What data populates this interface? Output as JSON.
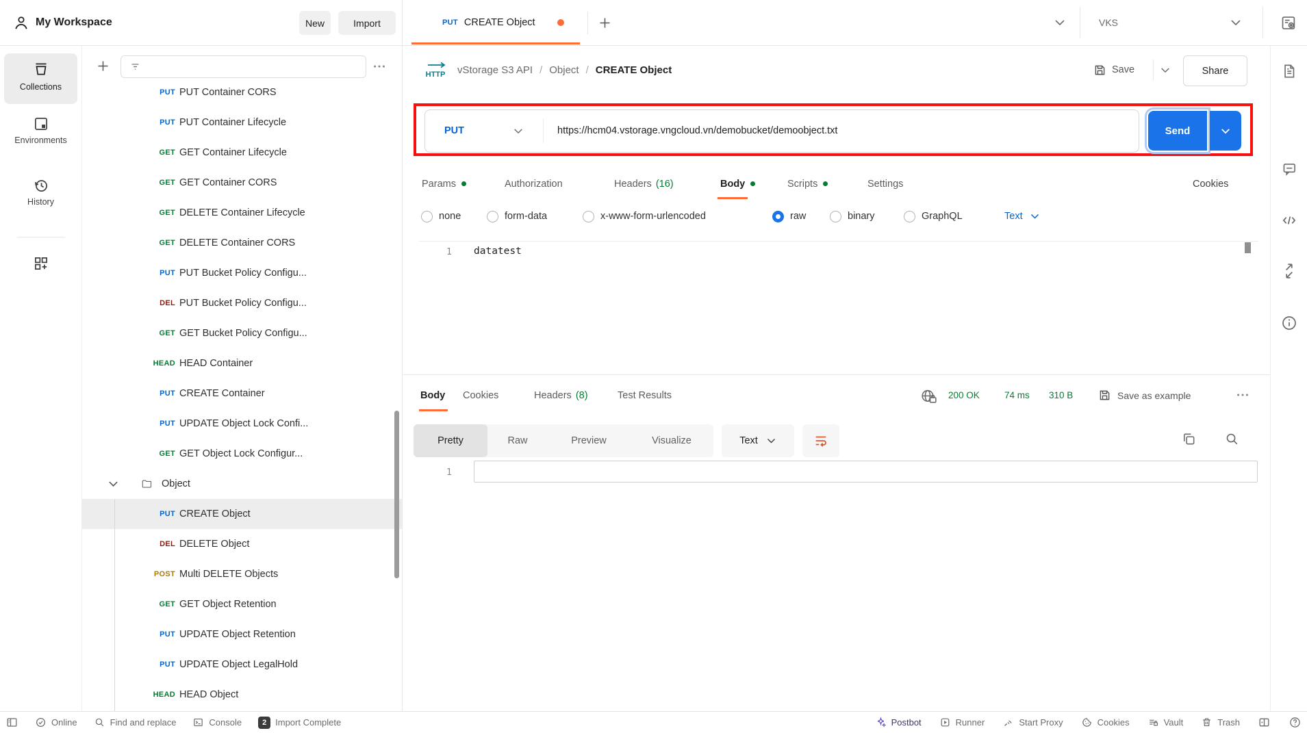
{
  "header": {
    "workspace_name": "My Workspace",
    "new_button": "New",
    "import_button": "Import"
  },
  "tab_bar": {
    "tab_method": "PUT",
    "tab_title": "CREATE Object",
    "environment_name": "VKS"
  },
  "nav_rail": {
    "collections": "Collections",
    "environments": "Environments",
    "history": "History"
  },
  "sidebar": {
    "items": [
      {
        "method": "PUT",
        "label": "PUT Container CORS"
      },
      {
        "method": "PUT",
        "label": "PUT Container Lifecycle"
      },
      {
        "method": "GET",
        "label": "GET Container Lifecycle"
      },
      {
        "method": "GET",
        "label": "GET Container CORS"
      },
      {
        "method": "GET",
        "label": "DELETE Container Lifecycle"
      },
      {
        "method": "GET",
        "label": "DELETE Container CORS"
      },
      {
        "method": "PUT",
        "label": "PUT Bucket Policy Configu..."
      },
      {
        "method": "DEL",
        "label": "PUT Bucket Policy Configu..."
      },
      {
        "method": "GET",
        "label": "GET Bucket Policy Configu..."
      },
      {
        "method": "HEAD",
        "label": "HEAD Container"
      },
      {
        "method": "PUT",
        "label": "CREATE Container"
      },
      {
        "method": "PUT",
        "label": "UPDATE Object Lock Confi..."
      },
      {
        "method": "GET",
        "label": "GET Object Lock Configur..."
      },
      {
        "folder_label": "Object"
      },
      {
        "method": "PUT",
        "label": "CREATE Object"
      },
      {
        "method": "DEL",
        "label": "DELETE Object"
      },
      {
        "method": "POST",
        "label": "Multi DELETE Objects"
      },
      {
        "method": "GET",
        "label": "GET Object Retention"
      },
      {
        "method": "PUT",
        "label": "UPDATE Object Retention"
      },
      {
        "method": "PUT",
        "label": "UPDATE Object LegalHold"
      },
      {
        "method": "HEAD",
        "label": "HEAD Object"
      }
    ]
  },
  "request": {
    "breadcrumb": {
      "collection": "vStorage S3 API",
      "separator": "/",
      "folder": "Object",
      "name": "CREATE Object"
    },
    "save_label": "Save",
    "share_label": "Share",
    "method": "PUT",
    "url": "https://hcm04.vstorage.vngcloud.vn/demobucket/demoobject.txt",
    "send_label": "Send",
    "tabs": {
      "params": "Params",
      "authorization": "Authorization",
      "headers": "Headers",
      "headers_count": "(16)",
      "body": "Body",
      "scripts": "Scripts",
      "settings": "Settings"
    },
    "cookies_link": "Cookies",
    "body_modes": {
      "none": "none",
      "form_data": "form-data",
      "urlencoded": "x-www-form-urlencoded",
      "raw": "raw",
      "binary": "binary",
      "graphql": "GraphQL",
      "language": "Text"
    },
    "editor": {
      "line_number": "1",
      "line1": "datatest"
    }
  },
  "response": {
    "tabs": {
      "body": "Body",
      "cookies": "Cookies",
      "headers": "Headers",
      "headers_count": "(8)",
      "test_results": "Test Results"
    },
    "status": "200 OK",
    "time": "74 ms",
    "size": "310 B",
    "save_as_example": "Save as example",
    "views": {
      "pretty": "Pretty",
      "raw": "Raw",
      "preview": "Preview",
      "visualize": "Visualize",
      "language": "Text"
    },
    "line_number": "1"
  },
  "status_bar": {
    "online": "Online",
    "find_and_replace": "Find and replace",
    "console": "Console",
    "import_badge": "2",
    "import_complete": "Import Complete",
    "postbot": "Postbot",
    "runner": "Runner",
    "start_proxy": "Start Proxy",
    "cookies": "Cookies",
    "vault": "Vault",
    "trash": "Trash"
  },
  "colors": {
    "accent_orange": "#ff6c37",
    "primary_blue": "#1a73e8",
    "method_put": "#0265d2",
    "method_get": "#007f31",
    "method_del": "#8e1a10",
    "method_post": "#ad7a03",
    "status_green": "#007f31",
    "annotation_red": "#f50f0f"
  }
}
